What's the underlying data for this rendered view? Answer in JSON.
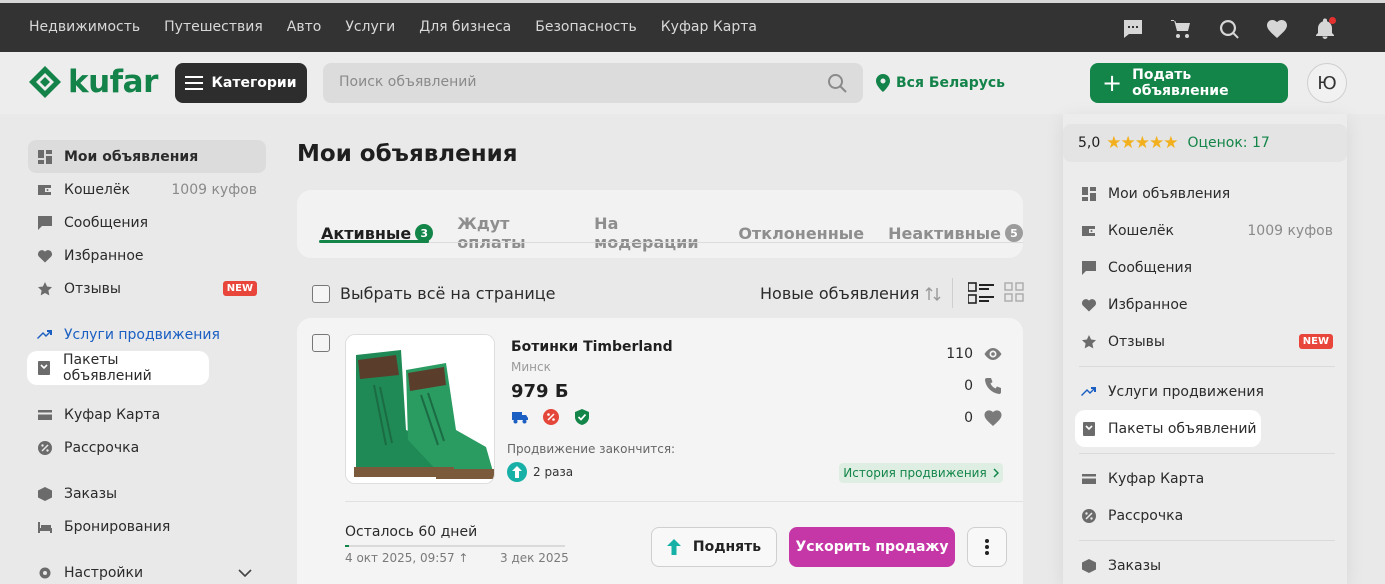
{
  "topnav": [
    "Недвижимость",
    "Путешествия",
    "Авто",
    "Услуги",
    "Для бизнеса",
    "Безопасность",
    "Куфар Карта"
  ],
  "header": {
    "logo": "kufar",
    "categories_label": "Категории",
    "search_placeholder": "Поиск объявлений",
    "region": "Вся Беларусь",
    "post_label": "Подать объявление",
    "avatar_letter": "Ю"
  },
  "sidebar": {
    "items": [
      {
        "label": "Мои объявления"
      },
      {
        "label": "Кошелёк",
        "extra": "1009 куфов"
      },
      {
        "label": "Сообщения"
      },
      {
        "label": "Избранное"
      },
      {
        "label": "Отзывы",
        "badge": "NEW"
      },
      {
        "label": "Услуги продвижения"
      },
      {
        "label": "Пакеты объявлений"
      },
      {
        "label": "Куфар Карта"
      },
      {
        "label": "Рассрочка"
      },
      {
        "label": "Заказы"
      },
      {
        "label": "Бронирования"
      },
      {
        "label": "Настройки"
      }
    ]
  },
  "main": {
    "title": "Мои объявления",
    "tabs": [
      {
        "label": "Активные",
        "count": "3"
      },
      {
        "label": "Ждут оплаты"
      },
      {
        "label": "На модерации"
      },
      {
        "label": "Отклоненные"
      },
      {
        "label": "Неактивные",
        "count": "5"
      }
    ],
    "select_all": "Выбрать всё на странице",
    "sort": "Новые объявления"
  },
  "ad": {
    "title": "Ботинки Timberland",
    "city": "Минск",
    "price": "979 Б",
    "views": "110",
    "calls": "0",
    "favorites": "0",
    "promo_label": "Продвижение закончится:",
    "promo_count": "2 раза",
    "history_label": "История продвижения",
    "days_left": "Осталось 60 дней",
    "progress": 0.02,
    "date_start": "4 окт 2025, 09:57",
    "date_end": "3 дек 2025",
    "raise_label": "Поднять",
    "speed_label": "Ускорить продажу"
  },
  "dropdown": {
    "rating": "5,0",
    "rating_count": "Оценок: 17",
    "stars": "★★★★★"
  },
  "colors": {
    "brand_green": "#138548",
    "accent_purple": "#c537a6",
    "link_blue": "#1b5fc2",
    "badge_red": "#e8463a"
  }
}
